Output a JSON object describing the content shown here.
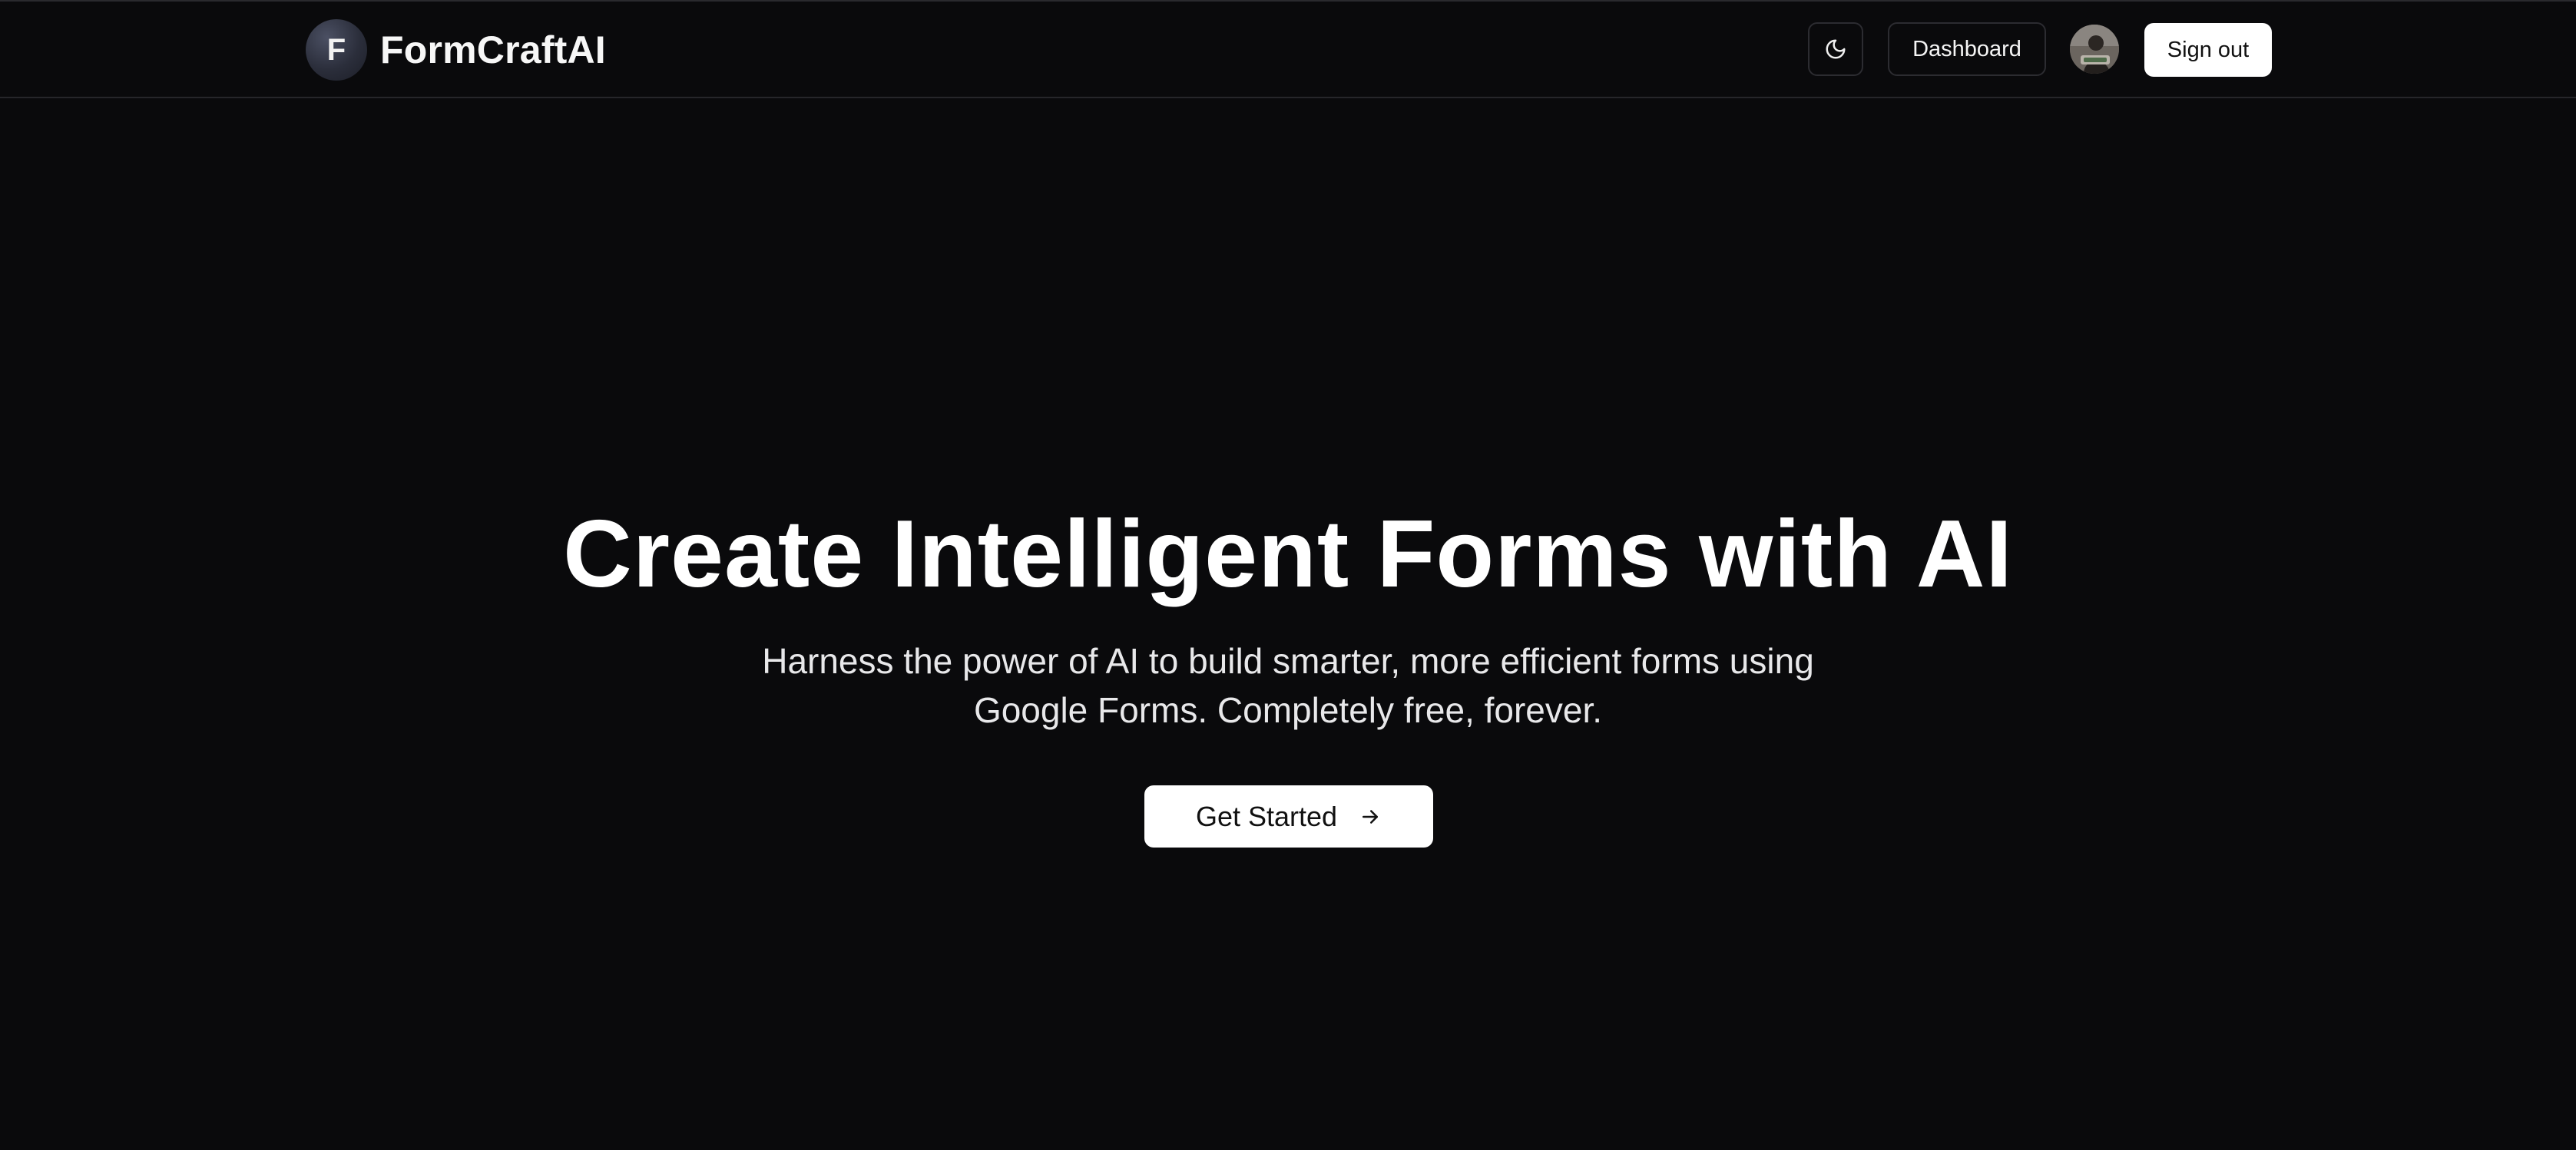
{
  "app": {
    "brand_initial": "F",
    "brand_name": "FormCraftAI"
  },
  "header": {
    "theme_toggle_icon": "moon-icon",
    "dashboard_label": "Dashboard",
    "signout_label": "Sign out",
    "avatar_icon": "user-avatar"
  },
  "hero": {
    "title": "Create Intelligent Forms with AI",
    "subtitle": "Harness the power of AI to build smarter, more efficient forms using Google Forms. Completely free, forever.",
    "cta_label": "Get Started",
    "cta_icon": "arrow-right-icon"
  },
  "colors": {
    "background": "#0a0a0c",
    "border": "#2c2c31",
    "primary_button": "#ffffff",
    "text": "#fafafa"
  }
}
